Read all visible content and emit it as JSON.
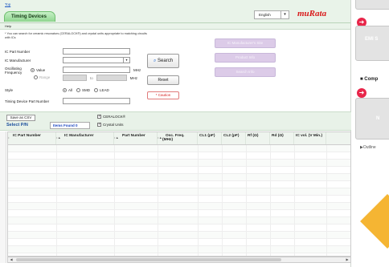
{
  "header": {
    "top_link": "Top",
    "tab_title": "Timing Devices",
    "language": "English",
    "brand": "muRata"
  },
  "help": "Help",
  "note": "* You can search for ceramic resonators (CERALOCK®) and crystal units appropriate to matching circuits with ICs",
  "form": {
    "ic_part_number_label": "IC Part Number",
    "ic_manufacturer_label": "IC Manufacturer",
    "oscillating_label": "Oscillating Frequency",
    "value_option": "Value",
    "range_option": "Range",
    "to_label": "to",
    "unit": "MHz",
    "style_label": "Style",
    "style_options": [
      "All",
      "SMD",
      "LEAD"
    ],
    "timing_pn_label": "Timing Device Part Number",
    "search_button": "Search",
    "reset_button": "Reset",
    "caution_button": "* Caution"
  },
  "side_buttons": [
    "IC Manufacturer's Site",
    "Product Info",
    "Search Info"
  ],
  "results": {
    "csv_button": "Save as CSV",
    "select_pn": "Select P/N",
    "items_found": "Items Found 0",
    "checkboxes": [
      "CERALOCK®",
      "Crystal Units"
    ],
    "columns": [
      "IC Part Number",
      "IC Manufacturer",
      "Part Number",
      "Osc. Freq. (MHz)",
      "CL1 (pF)",
      "CL2 (pF)",
      "Rf (Ω)",
      "Rd (Ω)",
      "IC vol. (V Min.)"
    ]
  },
  "right_panel": {
    "emi_label": "EMI S",
    "comp_heading": "■ Comp",
    "card_label": "N",
    "outline": "▶Outline"
  }
}
